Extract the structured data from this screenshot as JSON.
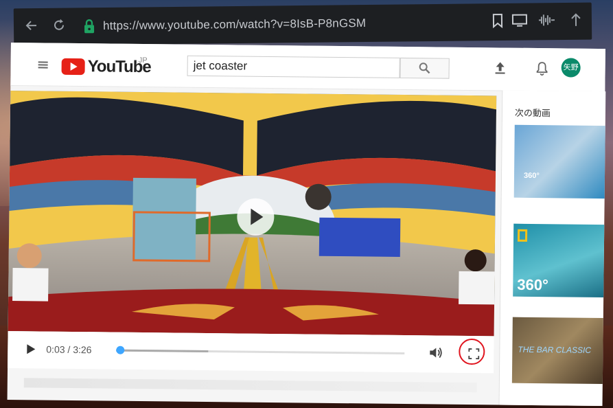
{
  "browser": {
    "url": "https://www.youtube.com/watch?v=8IsB-P8nGSM",
    "icons": [
      "back-arrow-icon",
      "reload-icon",
      "lock-icon",
      "bookmark-icon",
      "tab-switch-icon",
      "waveform-icon",
      "up-arrow-icon"
    ]
  },
  "header": {
    "logo_text": "YouTube",
    "logo_region": "JP",
    "search_value": "jet coaster",
    "avatar_text": "矢野"
  },
  "player": {
    "current_time": "0:03",
    "separator": " / ",
    "duration": "3:26",
    "progress_fraction": 0.015,
    "buffered_fraction": 0.32
  },
  "sidebar": {
    "heading": "次の動画",
    "thumbs": [
      {
        "badge": "360°",
        "style": "waterslide"
      },
      {
        "badge": "360°",
        "style": "shark"
      },
      {
        "badge": "THE BAR CLASSIC",
        "style": "city"
      }
    ]
  },
  "colors": {
    "brand_red": "#e62117",
    "avatar_green": "#0b8a6a",
    "progress_blue": "#3ea6ff",
    "annotation_red": "#e0141e"
  }
}
